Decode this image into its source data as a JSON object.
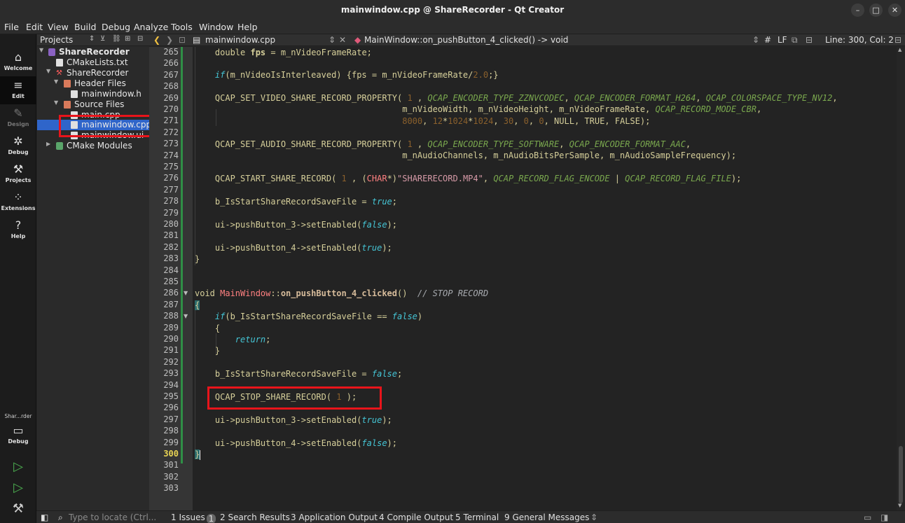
{
  "window": {
    "title": "mainwindow.cpp @ ShareRecorder - Qt Creator"
  },
  "menu": [
    "File",
    "Edit",
    "View",
    "Build",
    "Debug",
    "Analyze",
    "Tools",
    "Window",
    "Help"
  ],
  "modes": {
    "welcome": "Welcome",
    "edit": "Edit",
    "design": "Design",
    "debug": "Debug",
    "projects": "Projects",
    "extensions": "Extensions",
    "help": "Help"
  },
  "kit": {
    "name": "Shar...rder",
    "mode": "Debug"
  },
  "project_pane": {
    "selector": "Projects",
    "tree": [
      "ShareRecorder",
      "CMakeLists.txt",
      "ShareRecorder",
      "Header Files",
      "mainwindow.h",
      "Source Files",
      "main.cpp",
      "mainwindow.cpp",
      "mainwindow.ui",
      "CMake Modules"
    ]
  },
  "editor": {
    "file": "mainwindow.cpp",
    "symbol": "MainWindow::on_pushButton_4_clicked() -> void",
    "hash": "#",
    "line_ending": "LF",
    "position": "Line: 300, Col: 2",
    "current_line": "300"
  },
  "line_numbers": [
    "265",
    "266",
    "267",
    "268",
    "269",
    "270",
    "271",
    "272",
    "273",
    "274",
    "275",
    "276",
    "277",
    "278",
    "279",
    "280",
    "281",
    "282",
    "283",
    "284",
    "285",
    "286",
    "287",
    "288",
    "289",
    "290",
    "291",
    "292",
    "293",
    "294",
    "295",
    "296",
    "297",
    "298",
    "299",
    "300",
    "301",
    "302",
    "303"
  ],
  "code": {
    "l265_a": "double ",
    "l265_b": "fps",
    "l265_c": " = m_nVideoFrameRate;",
    "l267_a": "if",
    "l267_b": "(m_nVideoIsInterleaved) {fps = m_nVideoFrameRate/",
    "l267_c": "2.0",
    "l267_d": ";}",
    "l269_a": "QCAP_SET_VIDEO_SHARE_RECORD_PROPERTY( ",
    "l269_b": "1",
    "l269_c": " , ",
    "l269_d": "QCAP_ENCODER_TYPE_ZZNVCODEC",
    "l269_e": ", ",
    "l269_f": "QCAP_ENCODER_FORMAT_H264",
    "l269_g": ", ",
    "l269_h": "QCAP_COLORSPACE_TYPE_NV12",
    "l269_i": ",",
    "l270_a": "m_nVideoWidth, m_nVideoHeight, m_nVideoFrameRate, ",
    "l270_b": "QCAP_RECORD_MODE_CBR",
    "l270_c": ",",
    "l271_a": "8000",
    "l271_b": ", ",
    "l271_c": "12",
    "l271_d": "*",
    "l271_e": "1024",
    "l271_f": "*",
    "l271_g": "1024",
    "l271_h": ", ",
    "l271_i": "30",
    "l271_j": ", ",
    "l271_k": "0",
    "l271_l": ", ",
    "l271_m": "0",
    "l271_n": ", NULL, TRUE, FALSE);",
    "l273_a": "QCAP_SET_AUDIO_SHARE_RECORD_PROPERTY( ",
    "l273_b": "1",
    "l273_c": " , ",
    "l273_d": "QCAP_ENCODER_TYPE_SOFTWARE",
    "l273_e": ", ",
    "l273_f": "QCAP_ENCODER_FORMAT_AAC",
    "l273_g": ",",
    "l274": "m_nAudioChannels, m_nAudioBitsPerSample, m_nAudioSampleFrequency);",
    "l276_a": "QCAP_START_SHARE_RECORD( ",
    "l276_b": "1",
    "l276_c": " , (",
    "l276_d": "CHAR",
    "l276_e": "*)",
    "l276_f": "\"SHARERECORD.MP4\"",
    "l276_g": ", ",
    "l276_h": "QCAP_RECORD_FLAG_ENCODE",
    "l276_i": " | ",
    "l276_j": "QCAP_RECORD_FLAG_FILE",
    "l276_k": ");",
    "l278_a": "b_IsStartShareRecordSaveFile = ",
    "l278_b": "true",
    "l278_c": ";",
    "l280_a": "ui->pushButton_3->setEnabled(",
    "l280_b": "false",
    "l280_c": ");",
    "l282_a": "ui->pushButton_4->setEnabled(",
    "l282_b": "true",
    "l282_c": ");",
    "l283": "}",
    "l286_a": "void ",
    "l286_b": "MainWindow",
    "l286_c": "::",
    "l286_d": "on_pushButton_4_clicked",
    "l286_e": "()  ",
    "l286_f": "// STOP RECORD",
    "l287": "{",
    "l288_a": "if",
    "l288_b": "(b_IsStartShareRecordSaveFile == ",
    "l288_c": "false",
    "l288_d": ")",
    "l289": "{",
    "l290_a": "return",
    "l290_b": ";",
    "l291": "}",
    "l293_a": "b_IsStartShareRecordSaveFile = ",
    "l293_b": "false",
    "l293_c": ";",
    "l295_a": "QCAP_STOP_SHARE_RECORD( ",
    "l295_b": "1",
    "l295_c": " );",
    "l297_a": "ui->pushButton_3->setEnabled(",
    "l297_b": "true",
    "l297_c": ");",
    "l299_a": "ui->pushButton_4->setEnabled(",
    "l299_b": "false",
    "l299_c": ");",
    "l300": "}"
  },
  "output": {
    "locator_placeholder": "Type to locate (Ctrl...",
    "issues": "1  Issues",
    "issues_count": "1",
    "search": "2  Search Results",
    "app_output": "3  Application Output",
    "compile": "4  Compile Output",
    "terminal": "5  Terminal",
    "general": "9  General Messages"
  }
}
